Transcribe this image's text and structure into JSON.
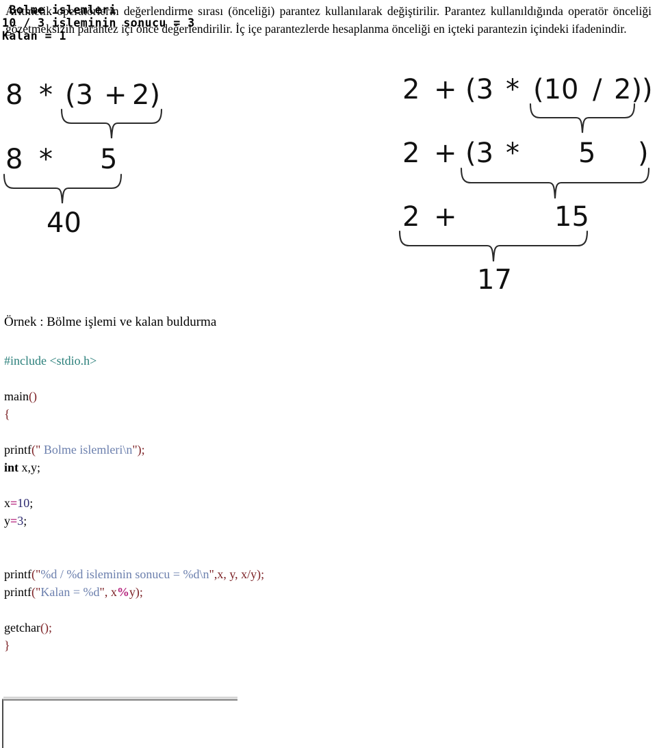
{
  "intro": {
    "paragraph": "Aritmetik operatörlerin değerlendirme sırası (önceliği) parantez kullanılarak değiştirilir. Parantez kullanıldığında operatör önceliği gözetmeksizin parantez içi önce değerlendirilir. İç içe parantezlerde hesaplanma önceliği en içteki parantezin içindeki ifadenindir."
  },
  "diagram_left": {
    "name": "carpma-parantez-ornegi",
    "rows": [
      {
        "tokens": [
          "8",
          "*",
          "(3",
          "+",
          "2)"
        ]
      },
      {
        "tokens": [
          "8",
          "*",
          "5"
        ]
      },
      {
        "tokens": [
          "40"
        ]
      }
    ],
    "steps": {
      "line1": "8 * (3 + 2)",
      "line2": "8 * 5",
      "line3": "40"
    }
  },
  "diagram_right": {
    "name": "ic-ice-parantez-ornegi",
    "rows": [
      {
        "tokens": [
          "2",
          "+",
          "(3",
          "*",
          "(10",
          "/",
          "2))"
        ]
      },
      {
        "tokens": [
          "2",
          "+",
          "(3",
          "*",
          "5",
          ")"
        ]
      },
      {
        "tokens": [
          "2",
          "+",
          "15"
        ]
      },
      {
        "tokens": [
          "17"
        ]
      }
    ],
    "steps": {
      "line1": "2 + (3 * (10 / 2))",
      "line2": "2 + (3 * 5 )",
      "line3": "2 + 15",
      "line4": "17"
    }
  },
  "example": {
    "heading": "Örnek : Bölme işlemi ve kalan buldurma"
  },
  "code": {
    "lines": [
      {
        "segments": [
          {
            "text": "#include <stdio.h>",
            "cls": "c-include"
          }
        ]
      },
      {
        "segments": []
      },
      {
        "segments": [
          {
            "text": "main",
            "cls": "c-plain"
          },
          {
            "text": "()",
            "cls": "c-punct"
          }
        ]
      },
      {
        "segments": [
          {
            "text": "{",
            "cls": "c-punct"
          }
        ]
      },
      {
        "segments": []
      },
      {
        "segments": [
          {
            "text": "printf",
            "cls": "c-plain"
          },
          {
            "text": "(\"",
            "cls": "c-punct"
          },
          {
            "text": " Bolme islemleri\\n",
            "cls": "c-string"
          },
          {
            "text": "\");",
            "cls": "c-punct"
          }
        ]
      },
      {
        "segments": [
          {
            "text": "int",
            "cls": "c-kw"
          },
          {
            "text": " x,y;",
            "cls": "c-plain"
          }
        ]
      },
      {
        "segments": []
      },
      {
        "segments": [
          {
            "text": "x",
            "cls": "c-plain"
          },
          {
            "text": "=",
            "cls": "c-op"
          },
          {
            "text": "10",
            "cls": "c-num"
          },
          {
            "text": ";",
            "cls": "c-plain"
          }
        ]
      },
      {
        "segments": [
          {
            "text": "y",
            "cls": "c-plain"
          },
          {
            "text": "=",
            "cls": "c-op"
          },
          {
            "text": "3",
            "cls": "c-num"
          },
          {
            "text": ";",
            "cls": "c-plain"
          }
        ]
      },
      {
        "segments": []
      },
      {
        "segments": []
      },
      {
        "segments": [
          {
            "text": "printf",
            "cls": "c-plain"
          },
          {
            "text": "(\"",
            "cls": "c-punct"
          },
          {
            "text": "%d / %d isleminin sonucu = %d\\n",
            "cls": "c-string"
          },
          {
            "text": "\",x, y, x/y);",
            "cls": "c-punct"
          }
        ]
      },
      {
        "segments": [
          {
            "text": "printf",
            "cls": "c-plain"
          },
          {
            "text": "(\"",
            "cls": "c-punct"
          },
          {
            "text": "Kalan = %d",
            "cls": "c-string"
          },
          {
            "text": "\", x",
            "cls": "c-punct"
          },
          {
            "text": "%",
            "cls": "c-op"
          },
          {
            "text": "y);",
            "cls": "c-punct"
          }
        ]
      },
      {
        "segments": []
      },
      {
        "segments": [
          {
            "text": "getchar",
            "cls": "c-plain"
          },
          {
            "text": "();",
            "cls": "c-punct"
          }
        ]
      },
      {
        "segments": [
          {
            "text": "}",
            "cls": "c-punct"
          }
        ]
      }
    ],
    "plain_text": "#include <stdio.h>\n\nmain()\n{\n\nprintf(\" Bolme islemleri\\n\");\nint x,y;\n\nx=10;\ny=3;\n\n\nprintf(\"%d / %d isleminin sonucu = %d\\n\",x, y, x/y);\nprintf(\"Kalan = %d\", x%y);\n\ngetchar();\n}"
  },
  "console": {
    "lines": [
      " Bolme islemleri",
      "10 / 3 isleminin sonucu = 3",
      "Kalan = 1"
    ]
  },
  "colors": {
    "include": "#2a7f7a",
    "punct": "#7a1f23",
    "string": "#6b7fad",
    "number": "#2d2a70",
    "operator": "#b5247d",
    "brace_stroke": "#2b2b2b",
    "console_border": "#9a9a9a"
  }
}
